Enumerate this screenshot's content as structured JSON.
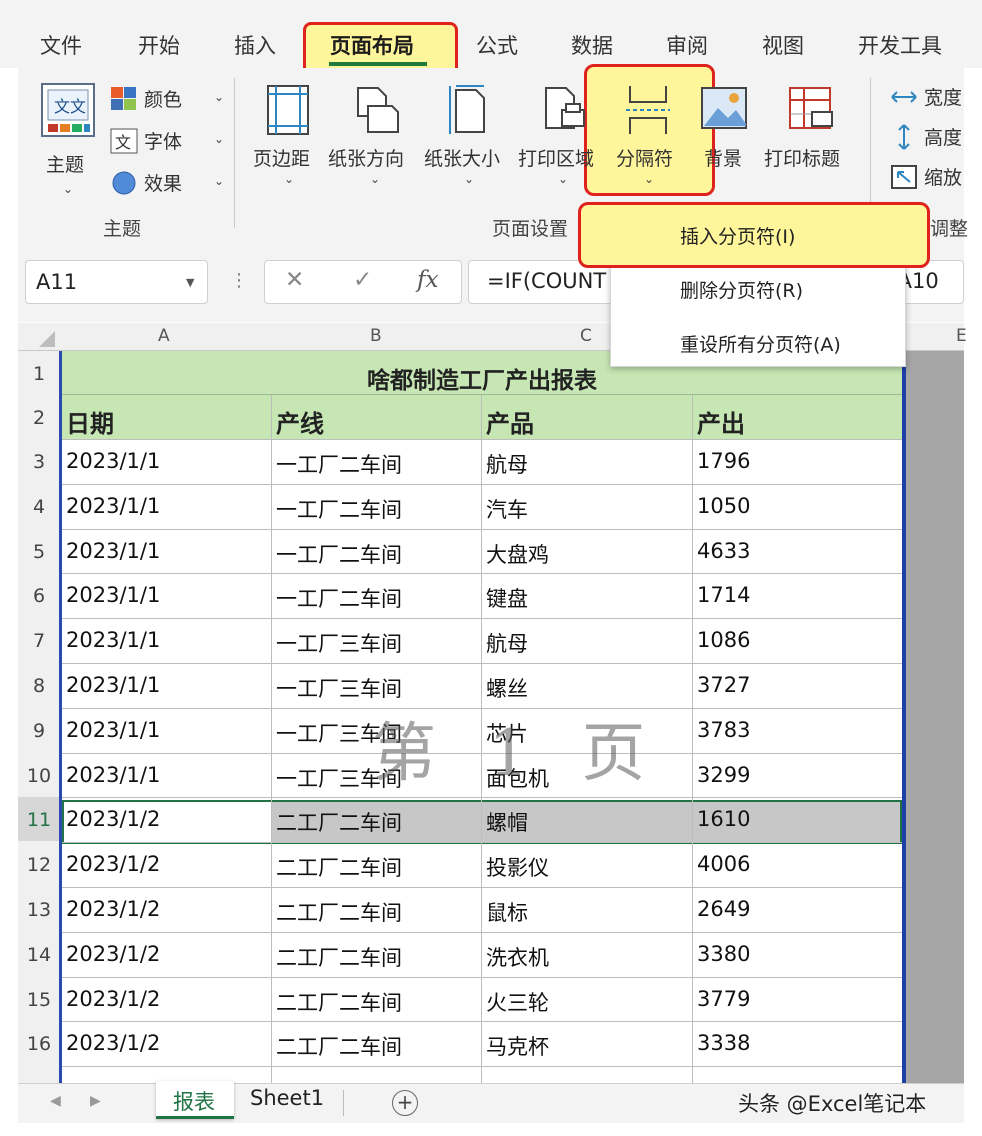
{
  "ribbon_tabs": [
    "文件",
    "开始",
    "插入",
    "页面布局",
    "公式",
    "数据",
    "审阅",
    "视图",
    "开发工具"
  ],
  "ribbon": {
    "theme_button": "主题",
    "theme_options": [
      "颜色",
      "字体",
      "效果"
    ],
    "theme_group_label": "主题",
    "page_setup_buttons": [
      "页边距",
      "纸张方向",
      "纸张大小",
      "打印区域",
      "分隔符",
      "背景",
      "打印标题"
    ],
    "page_setup_group_label": "页面设置",
    "scale_options": [
      "宽度",
      "高度",
      "缩放"
    ],
    "scale_group_label": "调整"
  },
  "breaks_menu": {
    "items": [
      "插入分页符(I)",
      "删除分页符(R)",
      "重设所有分页符(A)"
    ]
  },
  "formula_bar": {
    "name_box": "A11",
    "cancel": "✕",
    "enter": "✓",
    "fx": "fx",
    "formula_start": "=IF(COUNT",
    "formula_end": ",A10"
  },
  "sheet": {
    "column_headers": [
      "A",
      "B",
      "C",
      "E"
    ],
    "title": "啥都制造工厂产出报表",
    "headers": [
      "日期",
      "产线",
      "产品",
      "产出"
    ],
    "rows": [
      [
        "2023/1/1",
        "一工厂二车间",
        "航母",
        "1796"
      ],
      [
        "2023/1/1",
        "一工厂二车间",
        "汽车",
        "1050"
      ],
      [
        "2023/1/1",
        "一工厂二车间",
        "大盘鸡",
        "4633"
      ],
      [
        "2023/1/1",
        "一工厂二车间",
        "键盘",
        "1714"
      ],
      [
        "2023/1/1",
        "一工厂三车间",
        "航母",
        "1086"
      ],
      [
        "2023/1/1",
        "一工厂三车间",
        "螺丝",
        "3727"
      ],
      [
        "2023/1/1",
        "一工厂三车间",
        "芯片",
        "3783"
      ],
      [
        "2023/1/1",
        "一工厂三车间",
        "面包机",
        "3299"
      ],
      [
        "2023/1/2",
        "二工厂二车间",
        "螺帽",
        "1610"
      ],
      [
        "2023/1/2",
        "二工厂二车间",
        "投影仪",
        "4006"
      ],
      [
        "2023/1/2",
        "二工厂二车间",
        "鼠标",
        "2649"
      ],
      [
        "2023/1/2",
        "二工厂二车间",
        "洗衣机",
        "3380"
      ],
      [
        "2023/1/2",
        "二工厂二车间",
        "火三轮",
        "3779"
      ],
      [
        "2023/1/2",
        "二工厂二车间",
        "马克杯",
        "3338"
      ]
    ],
    "page_watermark": "第 1 页"
  },
  "sheet_tabs": {
    "tabs": [
      "报表",
      "Sheet1"
    ],
    "add": "+"
  },
  "credit": "头条 @Excel笔记本",
  "colors": {
    "accent_green": "#217346",
    "header_fill": "#c6e7b3",
    "highlight_yellow": "#fff59a",
    "highlight_red": "#e0221f",
    "page_break_blue": "#1f3fa8"
  }
}
